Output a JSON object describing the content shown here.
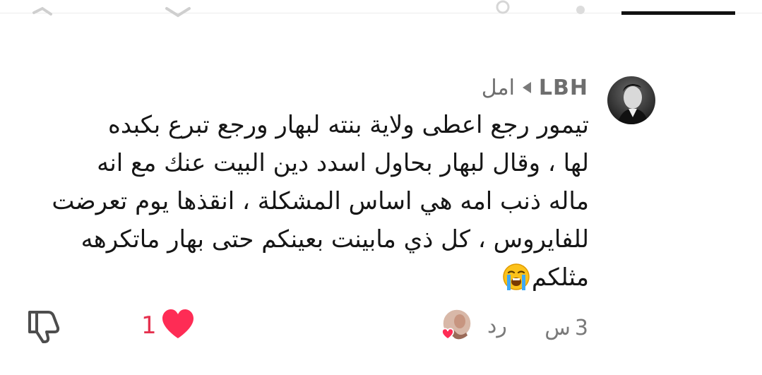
{
  "comment": {
    "username": "LBH",
    "reply_to": "امل",
    "lines": [
      "تيمور رجع اعطى ولاية بنته لبهار ورجع تبرع بكبده",
      "لها ، وقال لبهار بحاول اسدد دين البيت عنك مع انه",
      "ماله ذنب امه هي اساس المشكلة ، انقذها يوم تعرضت",
      "للفايروس ، كل ذي مابينت بعينكم حتى بهار ماتكرهه",
      "مثلكم"
    ],
    "emoji": "loudly-crying-face",
    "time_value": "3",
    "time_unit": "س",
    "reply_label": "رد",
    "like_count": "1",
    "liked": true
  },
  "colors": {
    "like": "#fe2c55",
    "muted_text": "#7a7a7a",
    "body_text": "#161616"
  },
  "icons": [
    "reply-arrow-icon",
    "heart-icon",
    "dislike-icon",
    "crying-emoji-icon"
  ]
}
